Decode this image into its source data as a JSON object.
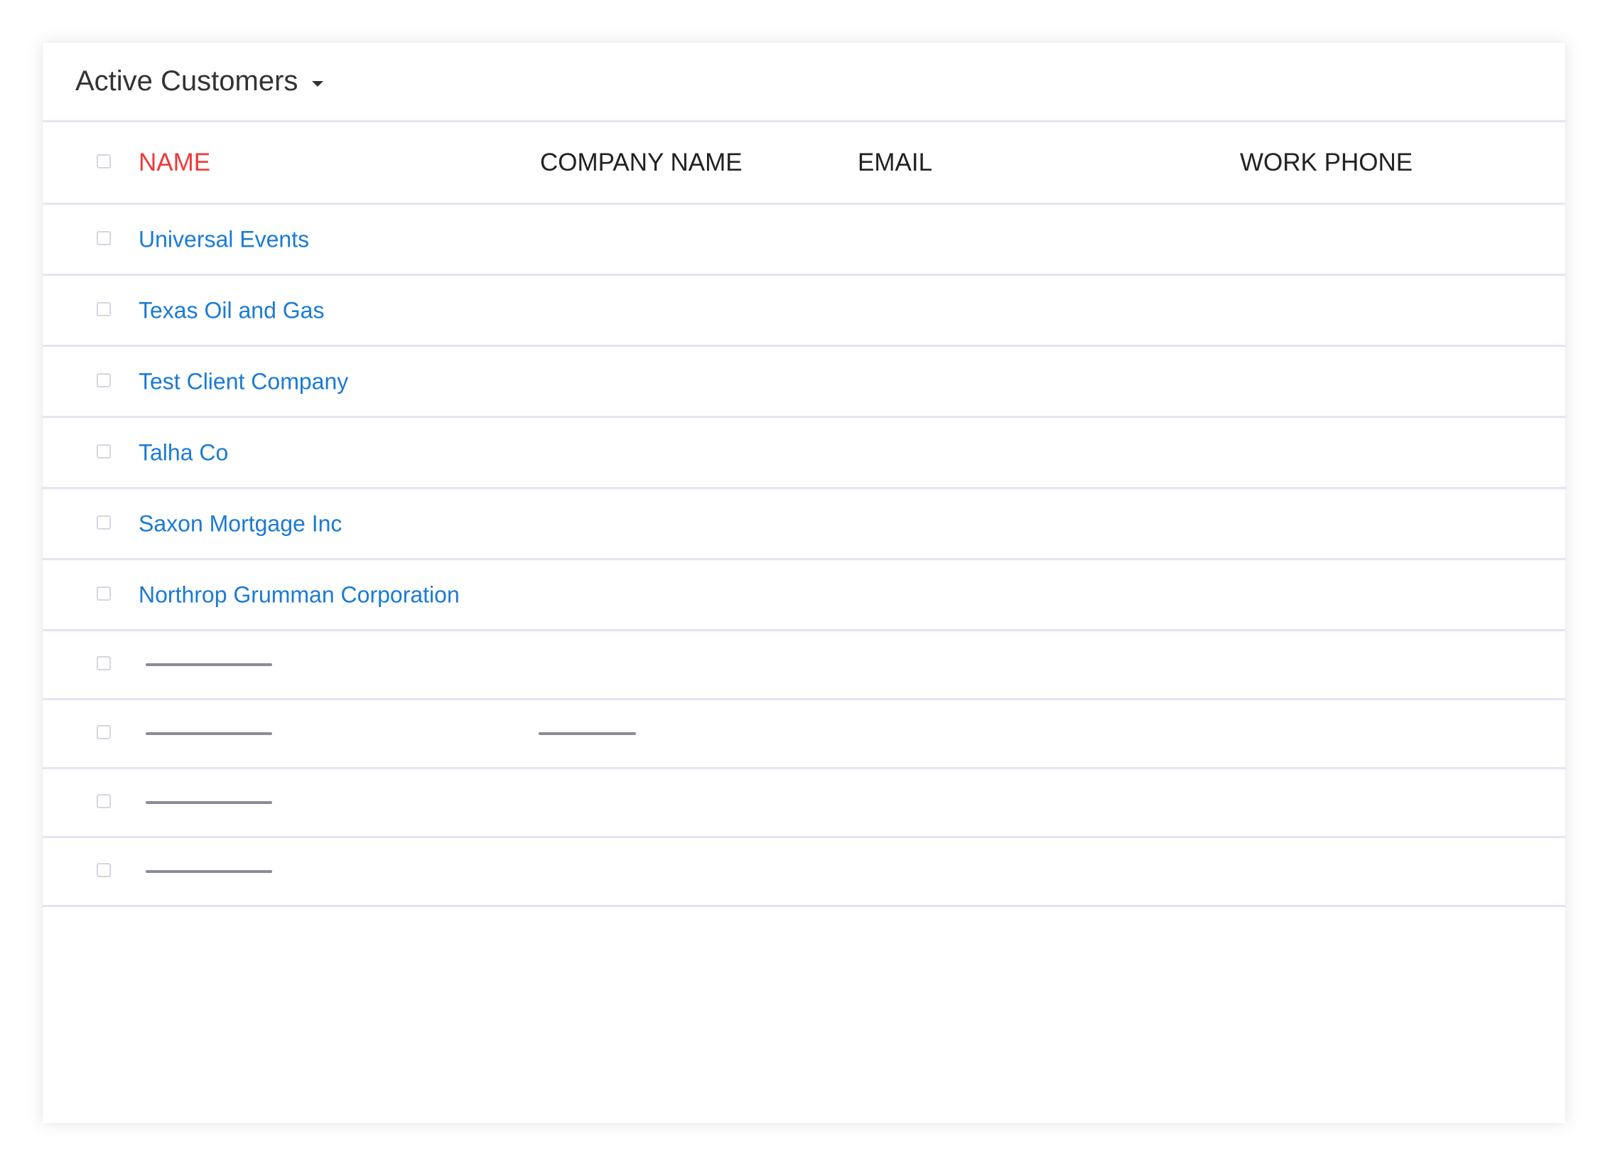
{
  "view": {
    "title": "Active Customers"
  },
  "table": {
    "columns": [
      "NAME",
      "COMPANY NAME",
      "EMAIL",
      "WORK PHONE"
    ],
    "rows": [
      {
        "name": "Universal Events"
      },
      {
        "name": "Texas Oil and Gas"
      },
      {
        "name": "Test Client Company"
      },
      {
        "name": "Talha Co"
      },
      {
        "name": "Saxon Mortgage Inc"
      },
      {
        "name": "Northrop Grumman Corporation"
      }
    ]
  },
  "colors": {
    "sorted_column": "#f03a3a",
    "link": "#1a7bd4",
    "divider": "#e4e4f4",
    "placeholder": "#8d8b98"
  }
}
